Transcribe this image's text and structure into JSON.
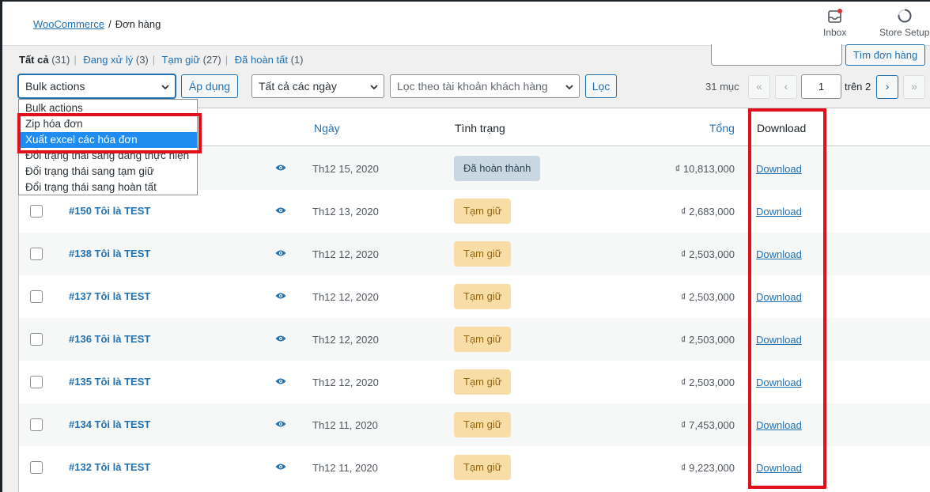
{
  "breadcrumb": {
    "root": "WooCommerce",
    "separator": "/",
    "current": "Đơn hàng"
  },
  "tools": {
    "inbox": "Inbox",
    "store_setup": "Store Setup"
  },
  "filters_links": [
    {
      "label": "Tất cả",
      "count": "(31)"
    },
    {
      "label": "Đang xử lý",
      "count": "(3)"
    },
    {
      "label": "Tạm giữ",
      "count": "(27)"
    },
    {
      "label": "Đã hoàn tất",
      "count": "(1)"
    }
  ],
  "search": {
    "value": "",
    "button": "Tìm đơn hàng"
  },
  "bulk": {
    "selected": "Bulk actions",
    "apply": "Áp dụng"
  },
  "date_filter": {
    "selected": "Tất cả các ngày"
  },
  "customer_filter": {
    "placeholder": "Lọc theo tài khoản khách hàng"
  },
  "filter_button": "Lọc",
  "pagination": {
    "count": "31 mục",
    "first": "«",
    "prev": "‹",
    "current": "1",
    "of": "trên 2",
    "next": "›",
    "last": "»"
  },
  "bulk_options": [
    "Bulk actions",
    "Zip hóa đơn",
    "Xuất excel các hóa đơn",
    "Đổi trạng thái sang đang thực hiện",
    "Đổi trạng thái sang tạm giữ",
    "Đổi trạng thái sang hoàn tất"
  ],
  "columns": {
    "date": "Ngày",
    "status": "Tình trạng",
    "total": "Tổng",
    "download": "Download"
  },
  "orders": [
    {
      "name": "",
      "date": "Th12 15, 2020",
      "status": "Đã hoàn thành",
      "status_type": "done",
      "total": "₫ 10,813,000",
      "download": "Download"
    },
    {
      "name": "#150 Tôi là TEST",
      "date": "Th12 13, 2020",
      "status": "Tạm giữ",
      "status_type": "hold",
      "total": "₫ 2,683,000",
      "download": "Download"
    },
    {
      "name": "#138 Tôi là TEST",
      "date": "Th12 12, 2020",
      "status": "Tạm giữ",
      "status_type": "hold",
      "total": "₫ 2,503,000",
      "download": "Download"
    },
    {
      "name": "#137 Tôi là TEST",
      "date": "Th12 12, 2020",
      "status": "Tạm giữ",
      "status_type": "hold",
      "total": "₫ 2,503,000",
      "download": "Download"
    },
    {
      "name": "#136 Tôi là TEST",
      "date": "Th12 12, 2020",
      "status": "Tạm giữ",
      "status_type": "hold",
      "total": "₫ 2,503,000",
      "download": "Download"
    },
    {
      "name": "#135 Tôi là TEST",
      "date": "Th12 12, 2020",
      "status": "Tạm giữ",
      "status_type": "hold",
      "total": "₫ 2,503,000",
      "download": "Download"
    },
    {
      "name": "#134 Tôi là TEST",
      "date": "Th12 11, 2020",
      "status": "Tạm giữ",
      "status_type": "hold",
      "total": "₫ 7,453,000",
      "download": "Download"
    },
    {
      "name": "#132 Tôi là TEST",
      "date": "Th12 11, 2020",
      "status": "Tạm giữ",
      "status_type": "hold",
      "total": "₫ 9,223,000",
      "download": "Download"
    }
  ],
  "colors": {
    "accent": "#2271b1",
    "highlight": "#e0101a",
    "selected_option": "#1e8cf0"
  }
}
